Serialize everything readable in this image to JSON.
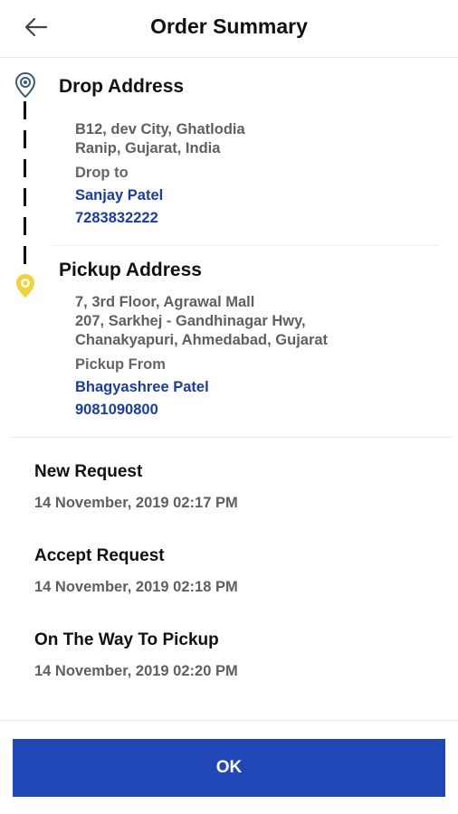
{
  "header": {
    "title": "Order Summary",
    "back_icon": "back-arrow-icon"
  },
  "drop": {
    "heading": "Drop Address",
    "address_lines": [
      "B12, dev City, Ghatlodia",
      "Ranip, Gujarat, India"
    ],
    "contact_label": "Drop to",
    "contact_name": "Sanjay Patel",
    "contact_phone": "7283832222",
    "icon": "drop-location-pin-icon"
  },
  "pickup": {
    "heading": "Pickup Address",
    "address_lines": [
      "7, 3rd Floor, Agrawal Mall",
      "207, Sarkhej - Gandhinagar Hwy,",
      "Chanakyapuri, Ahmedabad, Gujarat"
    ],
    "contact_label": "Pickup From",
    "contact_name": "Bhagyashree Patel",
    "contact_phone": "9081090800",
    "icon": "pickup-location-pin-icon"
  },
  "statuses": [
    {
      "title": "New Request",
      "time": "14 November, 2019 02:17 PM"
    },
    {
      "title": "Accept Request",
      "time": "14 November, 2019 02:18 PM"
    },
    {
      "title": "On The Way To Pickup",
      "time": "14 November, 2019 02:20 PM"
    }
  ],
  "footer": {
    "ok_label": "OK"
  },
  "colors": {
    "accent_blue": "#1f47b8",
    "contact_blue": "#1a3d9c",
    "drop_pin": "#3a5a7a",
    "pickup_pin": "#f2d236"
  }
}
